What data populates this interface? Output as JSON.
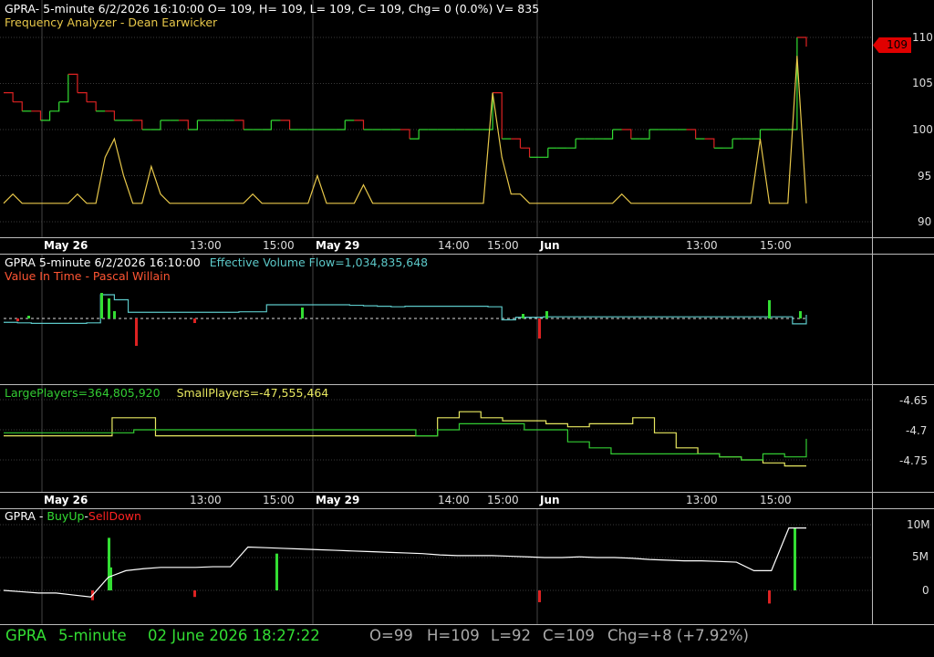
{
  "panel1": {
    "header": "GPRA- 5-minute 6/2/2026 16:10:00 O= 109, H= 109, L= 109, C= 109, Chg= 0 (0.0%) V= 835",
    "study": "Frequency Analyzer - Dean Earwicker",
    "price_tag": "109",
    "y_ticks": [
      "110",
      "105",
      "100",
      "95",
      "90"
    ]
  },
  "time_axis": {
    "labels": [
      {
        "text": "May 26",
        "bold": true
      },
      {
        "text": "13:00",
        "bold": false
      },
      {
        "text": "15:00",
        "bold": false
      },
      {
        "text": "May 29",
        "bold": true
      },
      {
        "text": "14:00",
        "bold": false
      },
      {
        "text": "15:00",
        "bold": false
      },
      {
        "text": "Jun",
        "bold": true
      },
      {
        "text": "13:00",
        "bold": false
      },
      {
        "text": "15:00",
        "bold": false
      }
    ]
  },
  "panel2": {
    "header_prefix": "GPRA 5-minute  6/2/2026 16:10:00",
    "header_value": "Effective Volume Flow=1,034,835,648",
    "study": "Value In Time - Pascal Willain"
  },
  "panel3": {
    "large": "LargePlayers=364,805,920",
    "small": "SmallPlayers=-47,555,464",
    "y_ticks": [
      "-4.65",
      "-4.7",
      "-4.75"
    ]
  },
  "panel4": {
    "prefix": "GPRA - ",
    "buy": "BuyUp",
    "dash": "-",
    "sell": "SellDown",
    "y_ticks": [
      "10M",
      "5M",
      "0"
    ]
  },
  "status": {
    "symbol": "GPRA",
    "interval": "5-minute",
    "datetime": "02 June 2026 18:27:22",
    "open": "O=99",
    "high": "H=109",
    "low": "L=92",
    "close": "C=109",
    "change": "Chg=+8 (+7.92%)"
  },
  "colors": {
    "up": "#33dd33",
    "down": "#dd2222",
    "oscillator": "#e8c84a",
    "flow_line": "#5cc8c8",
    "large": "#33cc33",
    "small": "#e8e860",
    "header_text": "#ffffff"
  },
  "chart_data": [
    {
      "type": "line",
      "title": "Frequency Analyzer - Dean Earwicker",
      "y_range": [
        88,
        112
      ],
      "series": [
        {
          "name": "price step",
          "values": [
            104,
            103,
            102,
            102,
            101,
            102,
            103,
            106,
            104,
            103,
            102,
            102,
            101,
            101,
            101,
            100,
            100,
            101,
            101,
            101,
            100,
            101,
            101,
            101,
            101,
            101,
            100,
            100,
            100,
            101,
            101,
            100,
            100,
            100,
            100,
            100,
            100,
            101,
            101,
            100,
            100,
            100,
            100,
            100,
            99,
            100,
            100,
            100,
            100,
            100,
            100,
            100,
            100,
            104,
            99,
            99,
            98,
            97,
            97,
            98,
            98,
            98,
            99,
            99,
            99,
            99,
            100,
            100,
            99,
            99,
            100,
            100,
            100,
            100,
            100,
            99,
            99,
            98,
            98,
            99,
            99,
            99,
            100,
            100,
            100,
            100,
            110,
            109
          ]
        },
        {
          "name": "oscillator",
          "values": [
            92,
            93,
            92,
            92,
            92,
            92,
            92,
            92,
            93,
            92,
            92,
            97,
            99,
            95,
            92,
            92,
            96,
            93,
            92,
            92,
            92,
            92,
            92,
            92,
            92,
            92,
            92,
            93,
            92,
            92,
            92,
            92,
            92,
            92,
            95,
            92,
            92,
            92,
            92,
            94,
            92,
            92,
            92,
            92,
            92,
            92,
            92,
            92,
            92,
            92,
            92,
            92,
            92,
            104,
            97,
            93,
            93,
            92,
            92,
            92,
            92,
            92,
            92,
            92,
            92,
            92,
            92,
            93,
            92,
            92,
            92,
            92,
            92,
            92,
            92,
            92,
            92,
            92,
            92,
            92,
            92,
            92,
            99,
            92,
            92,
            92,
            108,
            92
          ]
        }
      ]
    },
    {
      "type": "line",
      "title": "Value In Time - Pascal Willain",
      "series": [
        {
          "name": "Effective Volume Flow",
          "values": [
            0.45,
            0.44,
            0.43,
            0.43,
            0.43,
            0.43,
            0.44,
            1.0,
            0.9,
            0.65,
            0.65,
            0.65,
            0.65,
            0.65,
            0.65,
            0.65,
            0.65,
            0.66,
            0.66,
            0.8,
            0.8,
            0.8,
            0.8,
            0.8,
            0.8,
            0.79,
            0.78,
            0.77,
            0.76,
            0.77,
            0.77,
            0.77,
            0.77,
            0.77,
            0.77,
            0.76,
            0.5,
            0.55,
            0.55,
            0.56,
            0.56,
            0.56,
            0.56,
            0.56,
            0.56,
            0.56,
            0.56,
            0.56,
            0.56,
            0.56,
            0.56,
            0.56,
            0.56,
            0.56,
            0.56,
            0.56,
            0.56,
            0.42,
            0.6
          ]
        }
      ]
    },
    {
      "type": "line",
      "title": "LargePlayers / SmallPlayers",
      "y_ticks": [
        -4.65,
        -4.7,
        -4.75
      ],
      "series": [
        {
          "name": "LargePlayers",
          "values": [
            -4.705,
            -4.705,
            -4.705,
            -4.705,
            -4.705,
            -4.705,
            -4.7,
            -4.7,
            -4.7,
            -4.7,
            -4.7,
            -4.7,
            -4.7,
            -4.7,
            -4.7,
            -4.7,
            -4.7,
            -4.7,
            -4.7,
            -4.71,
            -4.7,
            -4.69,
            -4.69,
            -4.69,
            -4.7,
            -4.7,
            -4.72,
            -4.73,
            -4.74,
            -4.74,
            -4.74,
            -4.74,
            -4.74,
            -4.745,
            -4.75,
            -4.74,
            -4.745,
            -4.715
          ]
        },
        {
          "name": "SmallPlayers",
          "values": [
            -4.71,
            -4.71,
            -4.71,
            -4.71,
            -4.71,
            -4.68,
            -4.68,
            -4.71,
            -4.71,
            -4.71,
            -4.71,
            -4.71,
            -4.71,
            -4.71,
            -4.71,
            -4.71,
            -4.71,
            -4.71,
            -4.71,
            -4.71,
            -4.68,
            -4.67,
            -4.68,
            -4.685,
            -4.685,
            -4.69,
            -4.695,
            -4.69,
            -4.69,
            -4.68,
            -4.705,
            -4.73,
            -4.74,
            -4.745,
            -4.75,
            -4.755,
            -4.76,
            -4.76
          ]
        }
      ]
    },
    {
      "type": "line",
      "title": "BuyUp-SellDown",
      "y_range": [
        -1500000,
        10500000
      ],
      "y_ticks": [
        10000000,
        5000000,
        0
      ],
      "series": [
        {
          "name": "cumulative",
          "values": [
            0,
            -200000,
            -400000,
            -400000,
            -700000,
            -1000000,
            2000000,
            3000000,
            3300000,
            3500000,
            3500000,
            3500000,
            3600000,
            3600000,
            6600000,
            6500000,
            6400000,
            6300000,
            6200000,
            6100000,
            6000000,
            5900000,
            5800000,
            5700000,
            5600000,
            5400000,
            5300000,
            5300000,
            5300000,
            5200000,
            5100000,
            5000000,
            5000000,
            5100000,
            5000000,
            5000000,
            4900000,
            4700000,
            4600000,
            4500000,
            4500000,
            4400000,
            4300000,
            3000000,
            3000000,
            9500000,
            9500000
          ]
        }
      ]
    }
  ]
}
